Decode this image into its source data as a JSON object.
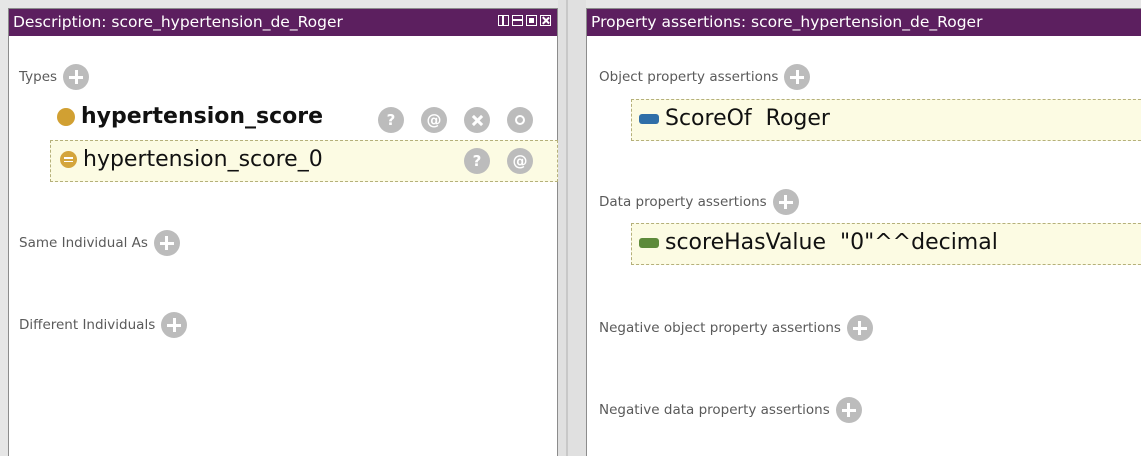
{
  "left": {
    "title": "Description: score_hypertension_de_Roger",
    "types_label": "Types",
    "type_class": "hypertension_score",
    "type_individual": "hypertension_score_0",
    "same_individual_label": "Same Individual As",
    "different_individuals_label": "Different Individuals",
    "button_glyphs": {
      "help": "?",
      "annotate": "@"
    }
  },
  "right": {
    "title": "Property assertions: score_hypertension_de_Roger",
    "object_assertions_label": "Object property assertions",
    "object_assertion": "ScoreOf  Roger",
    "data_assertions_label": "Data property assertions",
    "data_assertion": "scoreHasValue  \"0\"^^decimal",
    "neg_object_label": "Negative object property assertions",
    "neg_data_label": "Negative data property assertions"
  },
  "icons": {
    "class": "class-circle-icon",
    "individual": "individual-icon",
    "object_property": "object-property-icon",
    "data_property": "data-property-icon"
  },
  "colors": {
    "titlebar": "#5c1f5f",
    "class_dot": "#d1a032",
    "object_property": "#2f6ea8",
    "data_property": "#5d8a3a",
    "row_highlight": "#fcfbe3"
  }
}
